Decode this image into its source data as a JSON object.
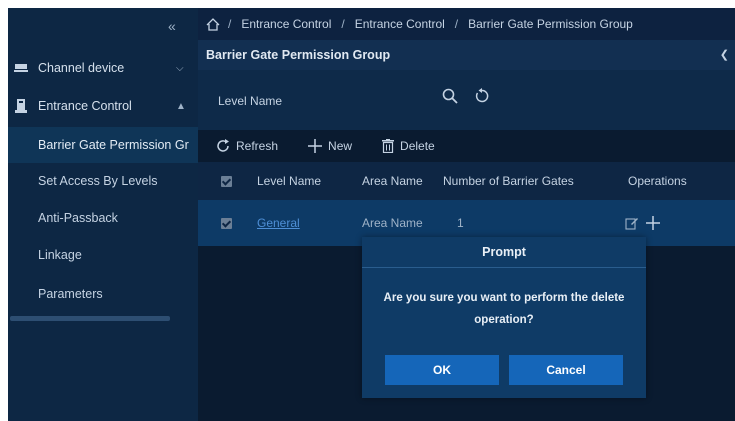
{
  "sidebar": {
    "collapse_label": "«",
    "menu": [
      {
        "label": "Channel device"
      },
      {
        "label": "Entrance Control"
      }
    ],
    "items": [
      {
        "label": "Barrier Gate Permission Gr"
      },
      {
        "label": "Set Access By Levels"
      },
      {
        "label": "Anti-Passback"
      },
      {
        "label": "Linkage"
      },
      {
        "label": "Parameters"
      }
    ]
  },
  "breadcrumb": {
    "items": [
      "Entrance Control",
      "Entrance Control",
      "Barrier Gate Permission Group"
    ],
    "separator": "/"
  },
  "page": {
    "title": "Barrier Gate Permission Group"
  },
  "filter": {
    "label": "Level Name",
    "value": ""
  },
  "toolbar": {
    "refresh": "Refresh",
    "new": "New",
    "delete": "Delete"
  },
  "table": {
    "headers": [
      "Level Name",
      "Area Name",
      "Number of Barrier Gates",
      "Operations"
    ],
    "rows": [
      {
        "level_name": "General",
        "area_name": "Area Name",
        "gates": "1"
      }
    ]
  },
  "dialog": {
    "title": "Prompt",
    "message": "Are you sure you want to perform the delete operation?",
    "ok": "OK",
    "cancel": "Cancel"
  },
  "colors": {
    "background": "#0b1d33",
    "sidebar": "#0d2744",
    "accent": "#1566b9",
    "selected_row": "#0d3a66"
  }
}
